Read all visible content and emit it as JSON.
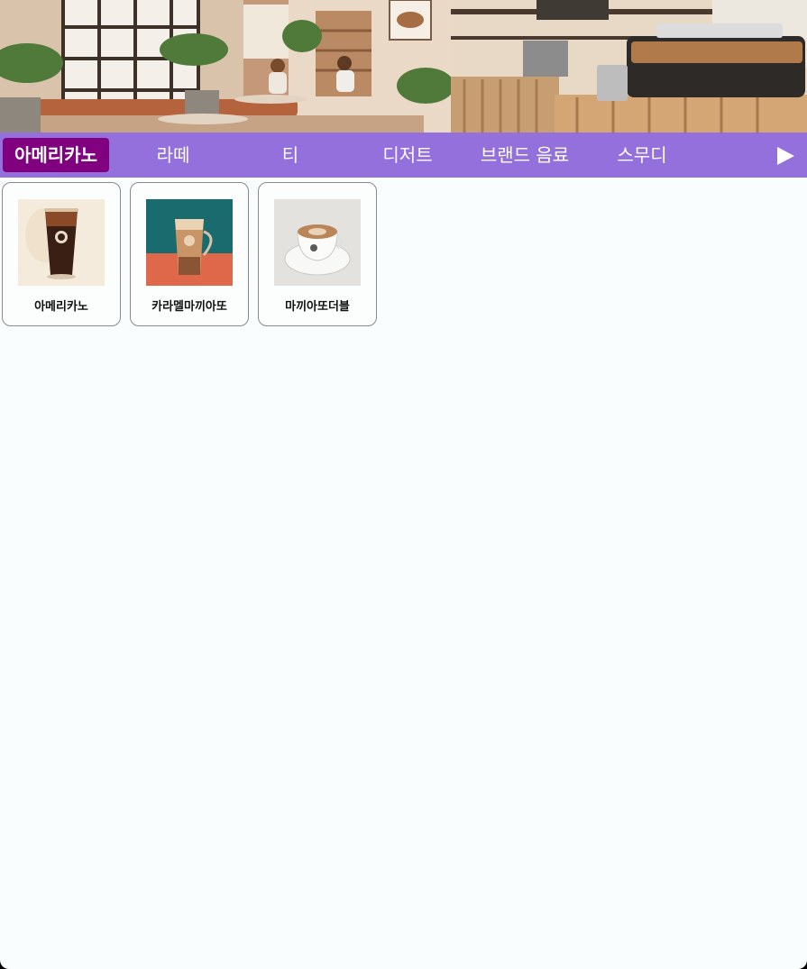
{
  "categories": [
    {
      "label": "아메리카노",
      "active": true
    },
    {
      "label": "라떼",
      "active": false
    },
    {
      "label": "티",
      "active": false
    },
    {
      "label": "디저트",
      "active": false
    },
    {
      "label": "브랜드 음료",
      "active": false
    },
    {
      "label": "스무디",
      "active": false
    }
  ],
  "products": [
    {
      "name": "아메리카노",
      "image": "iced-americano-cup"
    },
    {
      "name": "카라멜마끼아또",
      "image": "caramel-macchiato-glass"
    },
    {
      "name": "마끼아또더블",
      "image": "macchiato-cup-on-saucer"
    }
  ],
  "icons": {
    "next": "play-arrow-icon"
  },
  "colors": {
    "category_bar": "#9370db",
    "active_category": "#800080",
    "background": "#f9fdfe"
  }
}
